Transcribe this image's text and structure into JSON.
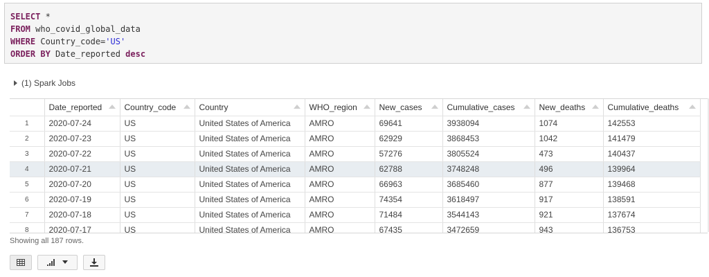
{
  "code": {
    "lines": [
      {
        "kw": "SELECT",
        "rest": " *",
        "str": "",
        "tail": ""
      },
      {
        "kw": "FROM",
        "rest": " who_covid_global_data",
        "str": "",
        "tail": ""
      },
      {
        "kw": "WHERE",
        "rest": " Country_code=",
        "str": "'US'",
        "tail": ""
      },
      {
        "kw": "ORDER BY",
        "rest": " Date_reported ",
        "str": "",
        "tail": "desc"
      }
    ]
  },
  "spark_jobs": "(1) Spark Jobs",
  "table": {
    "columns": [
      "Date_reported",
      "Country_code",
      "Country",
      "WHO_region",
      "New_cases",
      "Cumulative_cases",
      "New_deaths",
      "Cumulative_deaths"
    ],
    "rows": [
      [
        "1",
        "2020-07-24",
        "US",
        "United States of America",
        "AMRO",
        "69641",
        "3938094",
        "1074",
        "142553"
      ],
      [
        "2",
        "2020-07-23",
        "US",
        "United States of America",
        "AMRO",
        "62929",
        "3868453",
        "1042",
        "141479"
      ],
      [
        "3",
        "2020-07-22",
        "US",
        "United States of America",
        "AMRO",
        "57276",
        "3805524",
        "473",
        "140437"
      ],
      [
        "4",
        "2020-07-21",
        "US",
        "United States of America",
        "AMRO",
        "62788",
        "3748248",
        "496",
        "139964"
      ],
      [
        "5",
        "2020-07-20",
        "US",
        "United States of America",
        "AMRO",
        "66963",
        "3685460",
        "877",
        "139468"
      ],
      [
        "6",
        "2020-07-19",
        "US",
        "United States of America",
        "AMRO",
        "74354",
        "3618497",
        "917",
        "138591"
      ],
      [
        "7",
        "2020-07-18",
        "US",
        "United States of America",
        "AMRO",
        "71484",
        "3544143",
        "921",
        "137674"
      ],
      [
        "8",
        "2020-07-17",
        "US",
        "United States of America",
        "AMRO",
        "67435",
        "3472659",
        "943",
        "136753"
      ]
    ],
    "highlighted_row": 4
  },
  "status": "Showing all 187 rows.",
  "toolbar": {
    "icons": [
      "table-icon",
      "bar-chart-icon",
      "chevron-down-icon",
      "download-icon"
    ]
  }
}
